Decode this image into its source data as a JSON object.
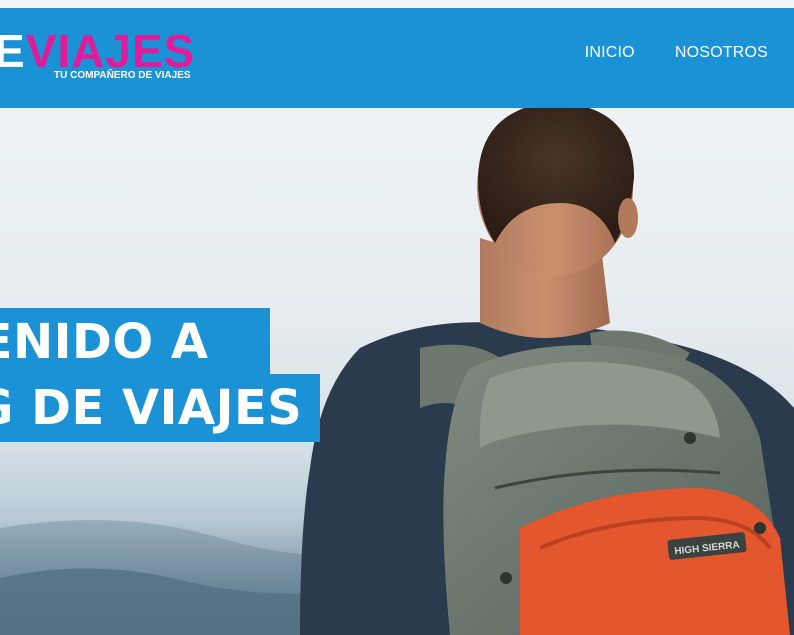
{
  "header": {
    "logo_part1": "E",
    "logo_part2": "VIAJES",
    "tagline": "TU COMPAÑERO DE VIAJES"
  },
  "nav": {
    "items": [
      {
        "label": "INICIO"
      },
      {
        "label": "NOSOTROS"
      }
    ]
  },
  "hero": {
    "line1": "VENIDO A",
    "line2": "G DE VIAJES",
    "backpack_brand": "HIGH SIERRA"
  },
  "colors": {
    "header_bg": "#1b92d6",
    "logo_accent": "#e21b9b",
    "title_bg": "#1b92d6",
    "backpack_orange": "#e4572e"
  }
}
